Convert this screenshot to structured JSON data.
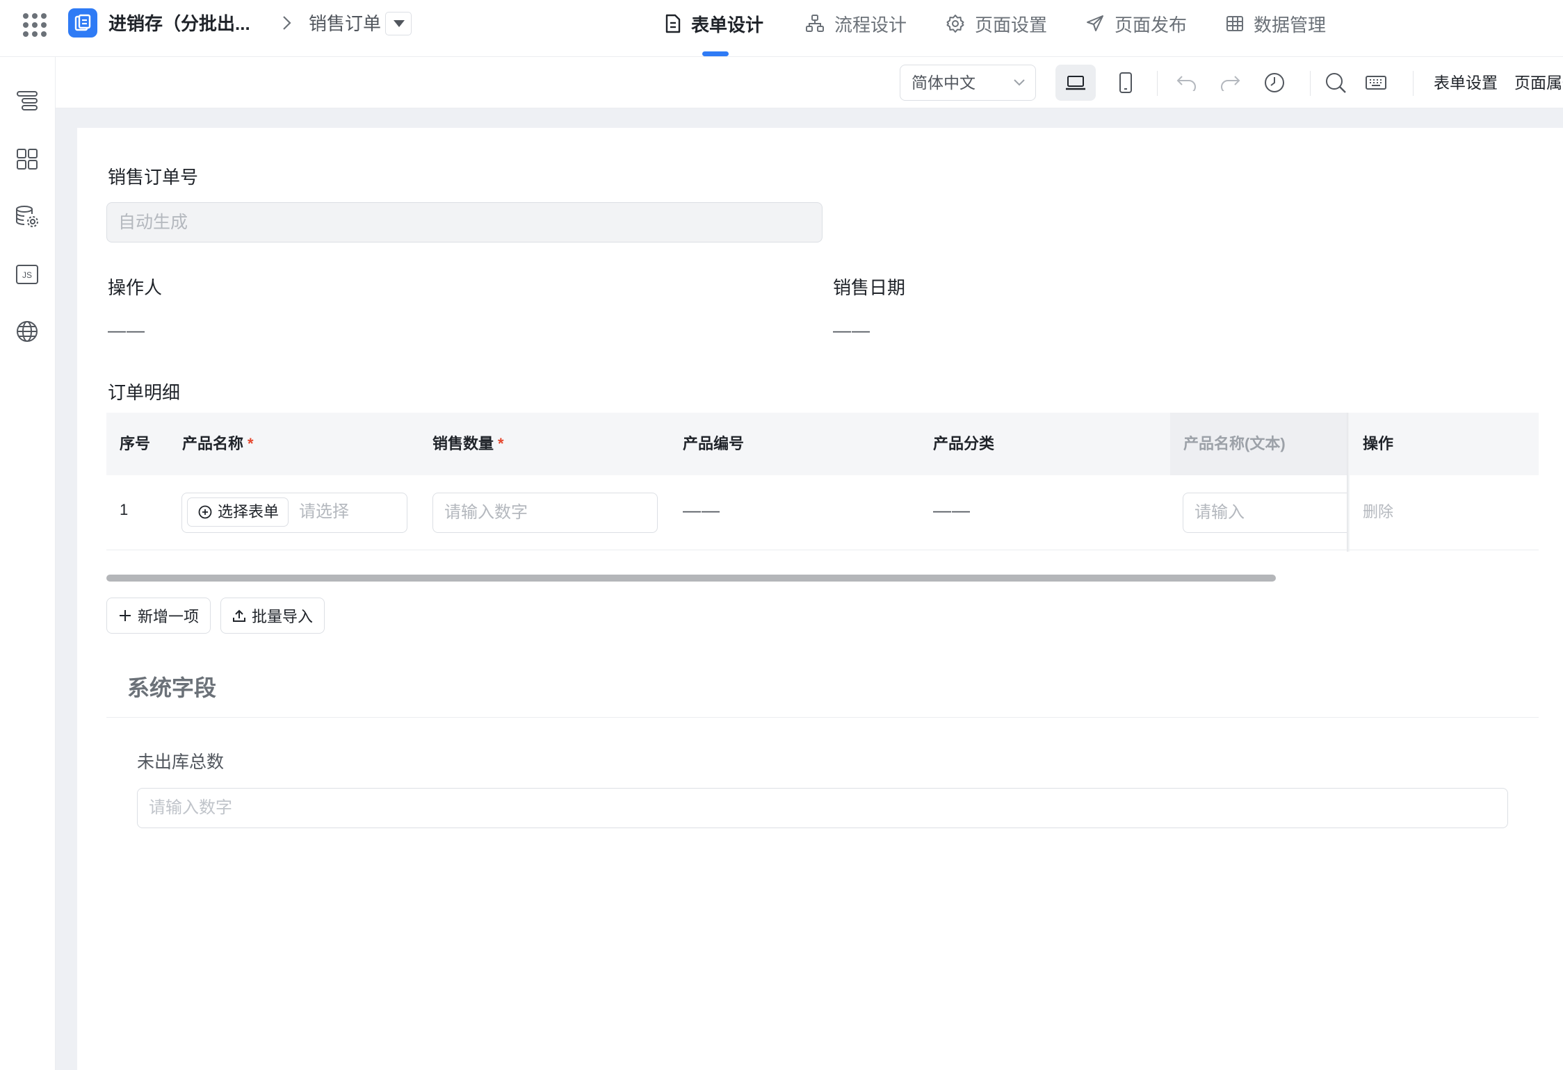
{
  "header": {
    "app_name": "进销存（分批出...",
    "page_name": "销售订单",
    "tabs": [
      {
        "label": "表单设计",
        "icon": "form-doc-icon"
      },
      {
        "label": "流程设计",
        "icon": "flow-icon"
      },
      {
        "label": "页面设置",
        "icon": "gear-icon"
      },
      {
        "label": "页面发布",
        "icon": "send-icon"
      },
      {
        "label": "数据管理",
        "icon": "table-grid-icon"
      }
    ],
    "active_tab": "表单设计"
  },
  "sidebar": {
    "icons": [
      "outline-tree-icon",
      "components-grid-icon",
      "data-source-icon",
      "js-code-icon",
      "globe-icon"
    ]
  },
  "toolbar": {
    "language": "简体中文",
    "form_settings": "表单设置",
    "page_props": "页面属性"
  },
  "form": {
    "order_no": {
      "label": "销售订单号",
      "placeholder": "自动生成"
    },
    "operator": {
      "label": "操作人",
      "value": "——"
    },
    "sale_date": {
      "label": "销售日期",
      "value": "——"
    },
    "detail": {
      "label": "订单明细",
      "columns": {
        "index": "序号",
        "product_name": "产品名称",
        "quantity": "销售数量",
        "product_code": "产品编号",
        "product_category": "产品分类",
        "product_name_text": "产品名称(文本)",
        "actions": "操作"
      },
      "required_mark": "*",
      "rows": [
        {
          "index": "1",
          "select_form_btn": "选择表单",
          "select_placeholder": "请选择",
          "quantity_placeholder": "请输入数字",
          "product_code": "——",
          "product_category": "——",
          "text_placeholder": "请输入",
          "delete": "删除"
        }
      ],
      "add_item": "新增一项",
      "batch_import": "批量导入"
    },
    "system_section": {
      "title": "系统字段",
      "unshipped_total": {
        "label": "未出库总数",
        "placeholder": "请输入数字"
      }
    }
  }
}
